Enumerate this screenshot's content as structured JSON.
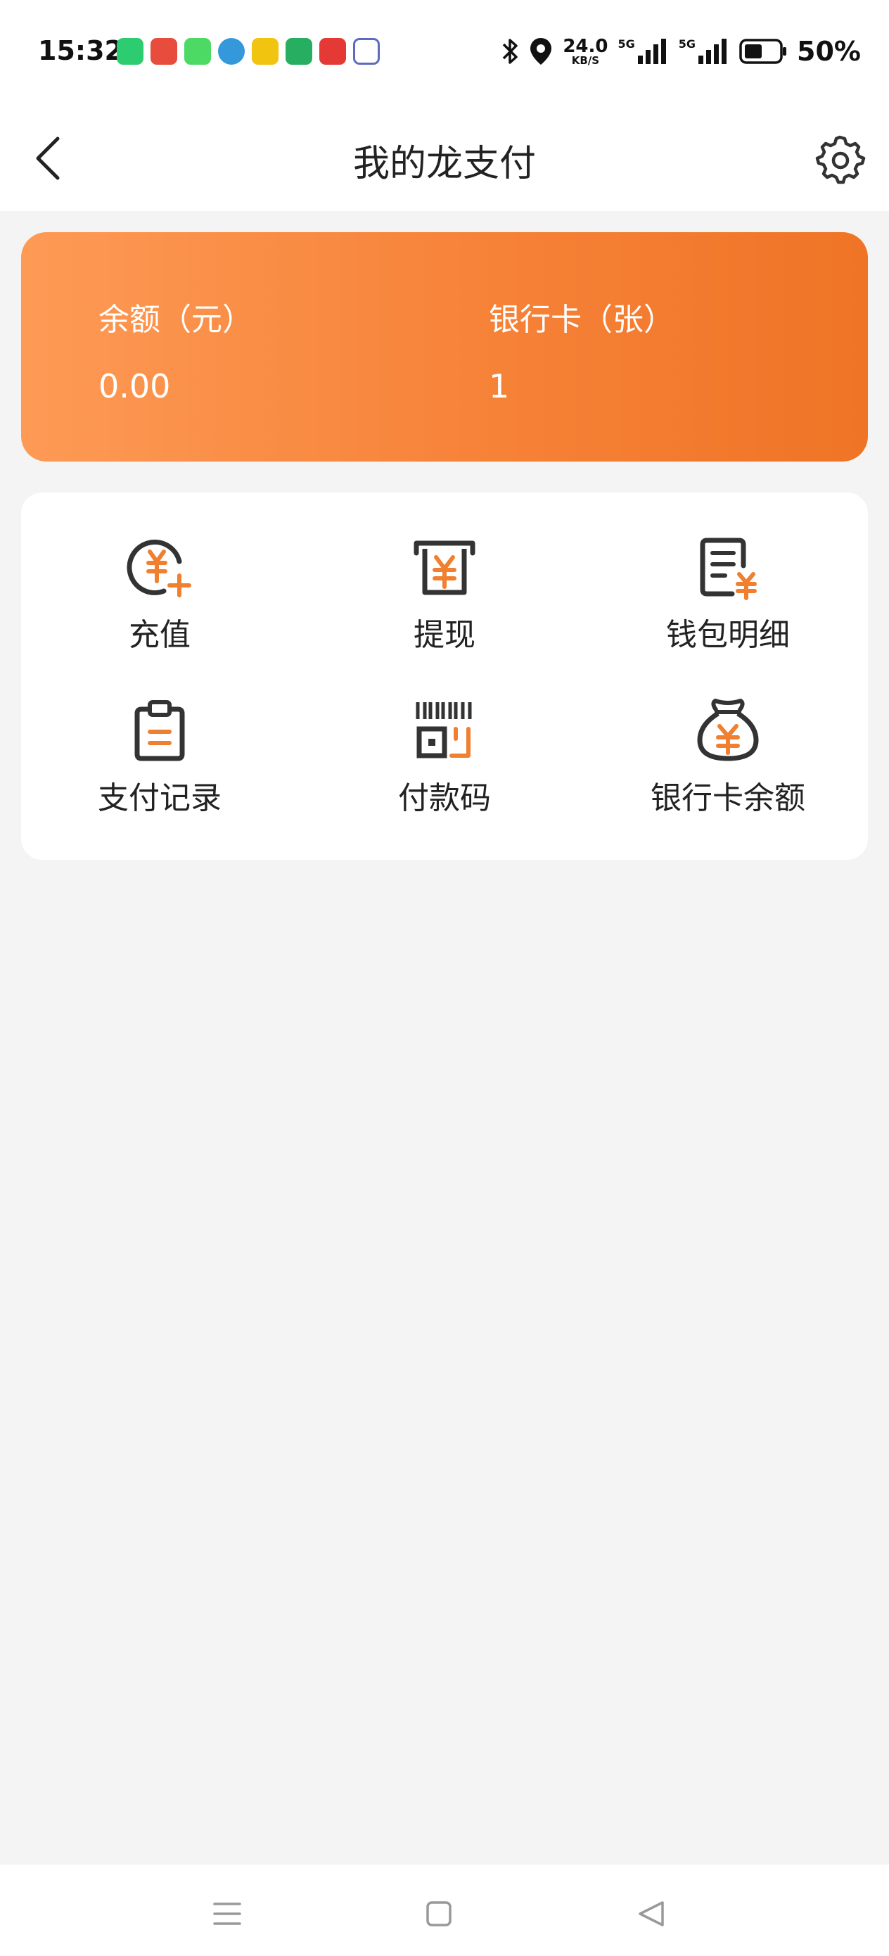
{
  "status_bar": {
    "time": "15:32",
    "net_speed_value": "24.0",
    "net_speed_unit": "KB/S",
    "signal_1": "5G",
    "signal_2": "5G",
    "battery_percent": "50%",
    "notification_colors": [
      "#2ecc71",
      "#e74c3c",
      "#4cd964",
      "#3498db",
      "#f1c40f",
      "#27ae60",
      "#e53935",
      "#5c6bc0"
    ]
  },
  "header": {
    "title": "我的龙支付",
    "back_icon": "chevron-left-icon",
    "settings_icon": "gear-icon"
  },
  "balance_card": {
    "balance_label": "余额（元）",
    "balance_value": "0.00",
    "cards_label": "银行卡（张）",
    "cards_value": "1"
  },
  "functions": [
    {
      "label": "充值",
      "icon": "recharge-icon"
    },
    {
      "label": "提现",
      "icon": "withdraw-icon"
    },
    {
      "label": "钱包明细",
      "icon": "wallet-detail-icon"
    },
    {
      "label": "支付记录",
      "icon": "payment-record-icon"
    },
    {
      "label": "付款码",
      "icon": "payment-code-icon"
    },
    {
      "label": "银行卡余额",
      "icon": "bank-card-balance-icon"
    }
  ],
  "colors": {
    "accent": "#f07f30",
    "icon_dark": "#333333",
    "background": "#f4f4f4"
  }
}
